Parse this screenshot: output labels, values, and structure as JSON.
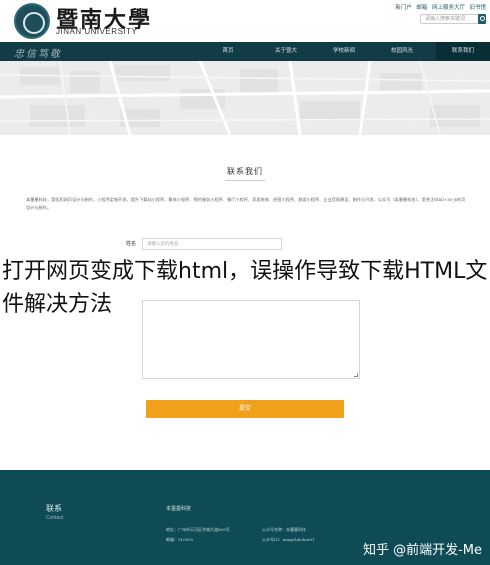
{
  "header": {
    "logo_cn": "暨南大學",
    "logo_en": "JINAN UNIVERSITY",
    "links": [
      "新门户",
      "邮箱",
      "网上服务大厅",
      "旧书馆"
    ],
    "search_placeholder": "请输入搜索关键词"
  },
  "nav": {
    "motto": "忠信笃敬",
    "items": [
      "首页",
      "关于暨大",
      "学校新闻",
      "校园风光",
      "联系我们"
    ],
    "active": "联系我们",
    "bg_color": "#113c46"
  },
  "contact": {
    "title": "联系我们",
    "intro": "本墨墨科技，是医药网页设计与制作，小程序定制开发，提升下载站小程序、集体小程序、预约服务小程序、餐厅小程序、家居装饰、经营小程序、旅游小程序、企业官网建设、制作与开发，公众号（本墨墨科技），是关注html-css-js的页设计与制作。",
    "name_label": "姓名",
    "name_placeholder": "请输入您的姓名",
    "submit_label": "提交"
  },
  "overlay": {
    "caption": "打开网页变成下载html，误操作导致下载HTML文件解决方法"
  },
  "footer": {
    "heading": "联系",
    "subheading": "Contact",
    "company": "本墨墨科技",
    "address_label": "地址：广州市天河区岑城大道809号",
    "postcode_label": "邮编：510000",
    "wechat_label": "公众号名称：本墨墨科技",
    "wechat_id_label": "公众号ID：mmpchitchat01",
    "bg_color": "#0f4b55"
  },
  "watermark": "知乎 @前端开发-Me",
  "colors": {
    "accent": "#f0a01a",
    "brand": "#113c46"
  }
}
